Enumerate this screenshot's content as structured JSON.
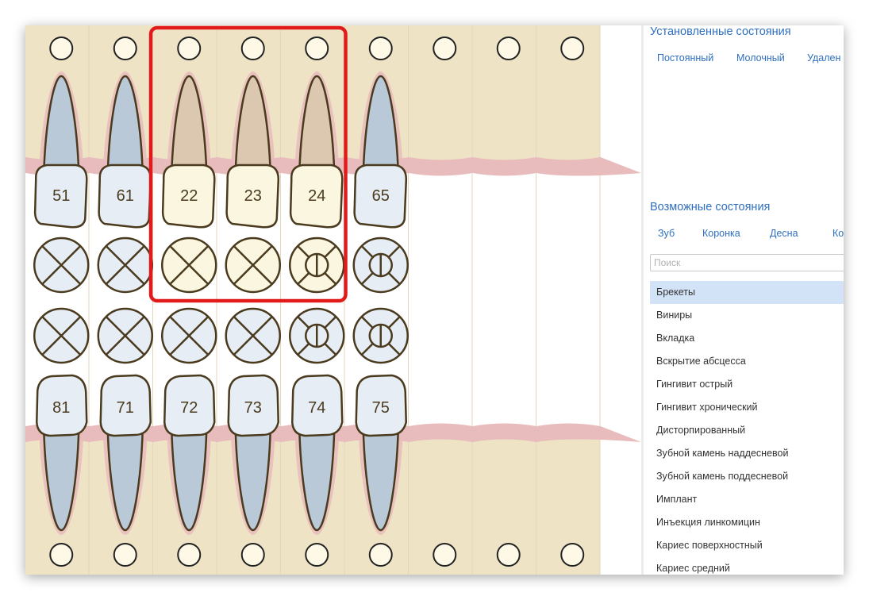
{
  "chart": {
    "upper_teeth": [
      {
        "number": "51",
        "tone": "blue"
      },
      {
        "number": "61",
        "tone": "blue"
      },
      {
        "number": "22",
        "tone": "beige"
      },
      {
        "number": "23",
        "tone": "beige"
      },
      {
        "number": "24",
        "tone": "beige"
      },
      {
        "number": "65",
        "tone": "blue"
      }
    ],
    "lower_teeth": [
      {
        "number": "81",
        "tone": "blue"
      },
      {
        "number": "71",
        "tone": "blue"
      },
      {
        "number": "72",
        "tone": "blue"
      },
      {
        "number": "73",
        "tone": "blue"
      },
      {
        "number": "74",
        "tone": "blue"
      },
      {
        "number": "75",
        "tone": "blue"
      }
    ],
    "upper_surface_icons": [
      "cross",
      "cross",
      "cross",
      "cross",
      "molar",
      "molar"
    ],
    "lower_surface_icons": [
      "cross",
      "cross",
      "cross",
      "cross",
      "molar",
      "molar"
    ],
    "selected_columns": [
      2,
      4
    ],
    "colors": {
      "background": "#efe3c6",
      "gum": "#e8bcbc",
      "root_blue": "#b9c9d8",
      "root_beige": "#dcc8b0",
      "crown_blue": "#e6edf5",
      "crown_beige": "#fbf6e0",
      "outline": "#4a3a1e",
      "selection": "#e11b1b"
    }
  },
  "panel": {
    "established_title": "Установленные состояния",
    "established_tabs": [
      "Постоянный",
      "Молочный",
      "Удален"
    ],
    "possible_title": "Возможные состояния",
    "possible_tabs": [
      "Зуб",
      "Коронка",
      "Десна",
      "Ко"
    ],
    "search_placeholder": "Поиск",
    "states": [
      "Брекеты",
      "Виниры",
      "Вкладка",
      "Вскрытие абсцесса",
      "Гингивит острый",
      "Гингивит хронический",
      "Дисторпированный",
      "Зубной камень наддесневой",
      "Зубной камень поддесневой",
      "Имплант",
      "Инъекция линкомицин",
      "Кариес поверхностный",
      "Кариес средний"
    ],
    "selected_state": 0
  }
}
